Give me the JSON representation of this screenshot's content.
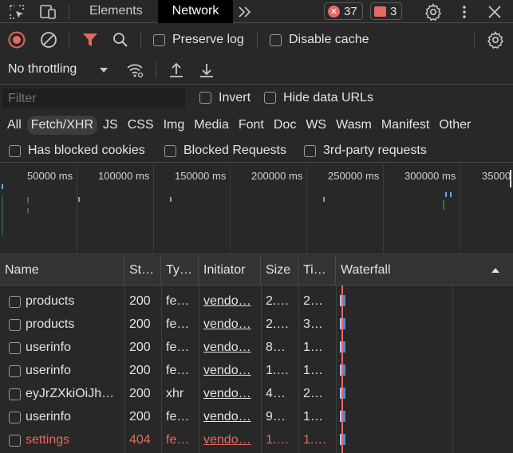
{
  "tabs": [
    {
      "label": "Elements",
      "active": false
    },
    {
      "label": "Network",
      "active": true
    }
  ],
  "errors_count": "37",
  "issues_count": "3",
  "toolbar": {
    "preserve_log": "Preserve log",
    "disable_cache": "Disable cache",
    "throttling": "No throttling"
  },
  "filter": {
    "placeholder": "Filter",
    "invert": "Invert",
    "hide_data_urls": "Hide data URLs"
  },
  "types": [
    "All",
    "Fetch/XHR",
    "JS",
    "CSS",
    "Img",
    "Media",
    "Font",
    "Doc",
    "WS",
    "Wasm",
    "Manifest",
    "Other"
  ],
  "active_type": "Fetch/XHR",
  "blocked": {
    "cookies": "Has blocked cookies",
    "requests": "Blocked Requests",
    "third_party": "3rd-party requests"
  },
  "timeline_ticks": [
    "50000 ms",
    "100000 ms",
    "150000 ms",
    "200000 ms",
    "250000 ms",
    "300000 ms",
    "35000"
  ],
  "columns": [
    "Name",
    "St…",
    "Ty…",
    "Initiator",
    "Size",
    "Ti…",
    "Waterfall"
  ],
  "rows": [
    {
      "name": "products",
      "status": "200",
      "type": "fe…",
      "initiator": "vendo…",
      "size": "2.…",
      "time": "2…",
      "error": false
    },
    {
      "name": "products",
      "status": "200",
      "type": "fe…",
      "initiator": "vendo…",
      "size": "2.…",
      "time": "3…",
      "error": false
    },
    {
      "name": "userinfo",
      "status": "200",
      "type": "fe…",
      "initiator": "vendo…",
      "size": "8…",
      "time": "1…",
      "error": false
    },
    {
      "name": "userinfo",
      "status": "200",
      "type": "fe…",
      "initiator": "vendo…",
      "size": "1.…",
      "time": "1…",
      "error": false
    },
    {
      "name": "eyJrZXkiOiJh…",
      "status": "200",
      "type": "xhr",
      "initiator": "vendo…",
      "size": "4…",
      "time": "2…",
      "error": false
    },
    {
      "name": "userinfo",
      "status": "200",
      "type": "fe…",
      "initiator": "vendo…",
      "size": "9…",
      "time": "1…",
      "error": false
    },
    {
      "name": "settings",
      "status": "404",
      "type": "fe…",
      "initiator": "vendo…",
      "size": "1.…",
      "time": "1.…",
      "error": true
    }
  ],
  "colors": {
    "accent_red": "#e46962",
    "filter_active": "#e46962",
    "waterfall_bar": "#3d8fe6"
  }
}
